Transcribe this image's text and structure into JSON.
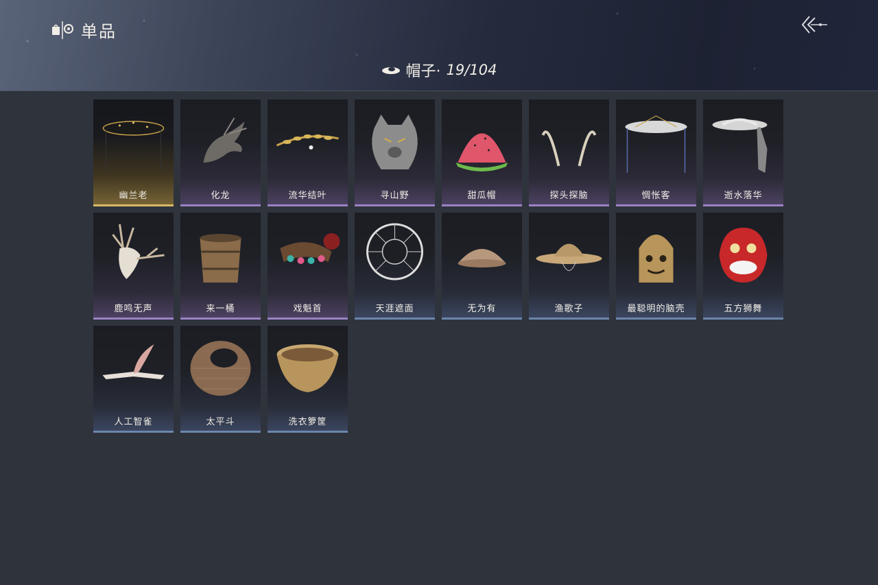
{
  "header": {
    "title": "单品",
    "title_icon": "wardrobe-icon",
    "back_icon": "double-chevron-back-icon"
  },
  "category": {
    "icon": "hat-icon",
    "label": "帽子·",
    "count": "19/104"
  },
  "items": [
    {
      "name": "幽兰老",
      "rarity": "gold",
      "icon": "black-veil-hat-icon"
    },
    {
      "name": "化龙",
      "rarity": "purple",
      "icon": "dragon-head-icon"
    },
    {
      "name": "流华结叶",
      "rarity": "purple",
      "icon": "golden-laurel-icon"
    },
    {
      "name": "寻山野",
      "rarity": "purple",
      "icon": "wolf-head-icon"
    },
    {
      "name": "甜瓜帽",
      "rarity": "purple",
      "icon": "watermelon-hat-icon"
    },
    {
      "name": "探头探脑",
      "rarity": "purple",
      "icon": "feather-antenna-icon"
    },
    {
      "name": "惆怅客",
      "rarity": "purple",
      "icon": "white-veil-hat-icon"
    },
    {
      "name": "逝水落华",
      "rarity": "purple",
      "icon": "silver-veil-hat-icon"
    },
    {
      "name": "鹿鸣无声",
      "rarity": "purple",
      "icon": "deer-skull-icon"
    },
    {
      "name": "来一桶",
      "rarity": "purple",
      "icon": "wooden-bucket-icon"
    },
    {
      "name": "戏魁首",
      "rarity": "purple",
      "icon": "opera-headdress-icon"
    },
    {
      "name": "天涯遮面",
      "rarity": "blue",
      "icon": "wicker-frame-hat-icon"
    },
    {
      "name": "无为有",
      "rarity": "blue",
      "icon": "clay-bowl-hat-icon"
    },
    {
      "name": "渔歌子",
      "rarity": "blue",
      "icon": "straw-hat-icon"
    },
    {
      "name": "最聪明的脑壳",
      "rarity": "blue",
      "icon": "bell-helmet-icon"
    },
    {
      "name": "五方狮舞",
      "rarity": "blue",
      "icon": "lion-dance-head-icon"
    },
    {
      "name": "人工智雀",
      "rarity": "blue",
      "icon": "bird-hat-icon"
    },
    {
      "name": "太平斗",
      "rarity": "blue",
      "icon": "bamboo-basket-icon"
    },
    {
      "name": "洗衣箩筐",
      "rarity": "blue",
      "icon": "laundry-basket-icon"
    }
  ]
}
